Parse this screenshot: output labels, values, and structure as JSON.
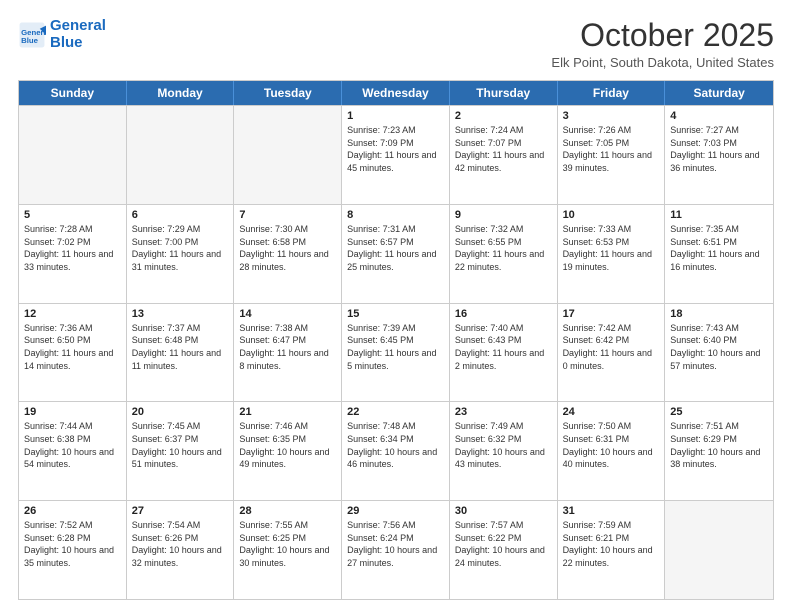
{
  "logo": {
    "line1": "General",
    "line2": "Blue"
  },
  "title": "October 2025",
  "subtitle": "Elk Point, South Dakota, United States",
  "weekdays": [
    "Sunday",
    "Monday",
    "Tuesday",
    "Wednesday",
    "Thursday",
    "Friday",
    "Saturday"
  ],
  "rows": [
    [
      {
        "day": "",
        "info": ""
      },
      {
        "day": "",
        "info": ""
      },
      {
        "day": "",
        "info": ""
      },
      {
        "day": "1",
        "info": "Sunrise: 7:23 AM\nSunset: 7:09 PM\nDaylight: 11 hours and 45 minutes."
      },
      {
        "day": "2",
        "info": "Sunrise: 7:24 AM\nSunset: 7:07 PM\nDaylight: 11 hours and 42 minutes."
      },
      {
        "day": "3",
        "info": "Sunrise: 7:26 AM\nSunset: 7:05 PM\nDaylight: 11 hours and 39 minutes."
      },
      {
        "day": "4",
        "info": "Sunrise: 7:27 AM\nSunset: 7:03 PM\nDaylight: 11 hours and 36 minutes."
      }
    ],
    [
      {
        "day": "5",
        "info": "Sunrise: 7:28 AM\nSunset: 7:02 PM\nDaylight: 11 hours and 33 minutes."
      },
      {
        "day": "6",
        "info": "Sunrise: 7:29 AM\nSunset: 7:00 PM\nDaylight: 11 hours and 31 minutes."
      },
      {
        "day": "7",
        "info": "Sunrise: 7:30 AM\nSunset: 6:58 PM\nDaylight: 11 hours and 28 minutes."
      },
      {
        "day": "8",
        "info": "Sunrise: 7:31 AM\nSunset: 6:57 PM\nDaylight: 11 hours and 25 minutes."
      },
      {
        "day": "9",
        "info": "Sunrise: 7:32 AM\nSunset: 6:55 PM\nDaylight: 11 hours and 22 minutes."
      },
      {
        "day": "10",
        "info": "Sunrise: 7:33 AM\nSunset: 6:53 PM\nDaylight: 11 hours and 19 minutes."
      },
      {
        "day": "11",
        "info": "Sunrise: 7:35 AM\nSunset: 6:51 PM\nDaylight: 11 hours and 16 minutes."
      }
    ],
    [
      {
        "day": "12",
        "info": "Sunrise: 7:36 AM\nSunset: 6:50 PM\nDaylight: 11 hours and 14 minutes."
      },
      {
        "day": "13",
        "info": "Sunrise: 7:37 AM\nSunset: 6:48 PM\nDaylight: 11 hours and 11 minutes."
      },
      {
        "day": "14",
        "info": "Sunrise: 7:38 AM\nSunset: 6:47 PM\nDaylight: 11 hours and 8 minutes."
      },
      {
        "day": "15",
        "info": "Sunrise: 7:39 AM\nSunset: 6:45 PM\nDaylight: 11 hours and 5 minutes."
      },
      {
        "day": "16",
        "info": "Sunrise: 7:40 AM\nSunset: 6:43 PM\nDaylight: 11 hours and 2 minutes."
      },
      {
        "day": "17",
        "info": "Sunrise: 7:42 AM\nSunset: 6:42 PM\nDaylight: 11 hours and 0 minutes."
      },
      {
        "day": "18",
        "info": "Sunrise: 7:43 AM\nSunset: 6:40 PM\nDaylight: 10 hours and 57 minutes."
      }
    ],
    [
      {
        "day": "19",
        "info": "Sunrise: 7:44 AM\nSunset: 6:38 PM\nDaylight: 10 hours and 54 minutes."
      },
      {
        "day": "20",
        "info": "Sunrise: 7:45 AM\nSunset: 6:37 PM\nDaylight: 10 hours and 51 minutes."
      },
      {
        "day": "21",
        "info": "Sunrise: 7:46 AM\nSunset: 6:35 PM\nDaylight: 10 hours and 49 minutes."
      },
      {
        "day": "22",
        "info": "Sunrise: 7:48 AM\nSunset: 6:34 PM\nDaylight: 10 hours and 46 minutes."
      },
      {
        "day": "23",
        "info": "Sunrise: 7:49 AM\nSunset: 6:32 PM\nDaylight: 10 hours and 43 minutes."
      },
      {
        "day": "24",
        "info": "Sunrise: 7:50 AM\nSunset: 6:31 PM\nDaylight: 10 hours and 40 minutes."
      },
      {
        "day": "25",
        "info": "Sunrise: 7:51 AM\nSunset: 6:29 PM\nDaylight: 10 hours and 38 minutes."
      }
    ],
    [
      {
        "day": "26",
        "info": "Sunrise: 7:52 AM\nSunset: 6:28 PM\nDaylight: 10 hours and 35 minutes."
      },
      {
        "day": "27",
        "info": "Sunrise: 7:54 AM\nSunset: 6:26 PM\nDaylight: 10 hours and 32 minutes."
      },
      {
        "day": "28",
        "info": "Sunrise: 7:55 AM\nSunset: 6:25 PM\nDaylight: 10 hours and 30 minutes."
      },
      {
        "day": "29",
        "info": "Sunrise: 7:56 AM\nSunset: 6:24 PM\nDaylight: 10 hours and 27 minutes."
      },
      {
        "day": "30",
        "info": "Sunrise: 7:57 AM\nSunset: 6:22 PM\nDaylight: 10 hours and 24 minutes."
      },
      {
        "day": "31",
        "info": "Sunrise: 7:59 AM\nSunset: 6:21 PM\nDaylight: 10 hours and 22 minutes."
      },
      {
        "day": "",
        "info": ""
      }
    ]
  ]
}
